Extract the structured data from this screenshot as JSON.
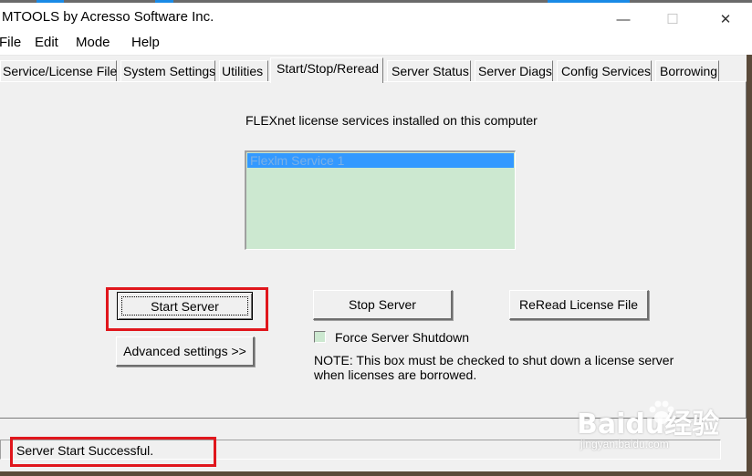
{
  "window": {
    "title": "MTOOLS by Acresso Software Inc.",
    "controls": {
      "minimize": "—",
      "maximize": "☐",
      "close": "✕"
    }
  },
  "menu": [
    "File",
    "Edit",
    "Mode",
    "Help"
  ],
  "tabs": [
    {
      "label": "Service/License File",
      "active": false
    },
    {
      "label": "System Settings",
      "active": false
    },
    {
      "label": "Utilities",
      "active": false
    },
    {
      "label": "Start/Stop/Reread",
      "active": true
    },
    {
      "label": "Server Status",
      "active": false
    },
    {
      "label": "Server Diags",
      "active": false
    },
    {
      "label": "Config Services",
      "active": false
    },
    {
      "label": "Borrowing",
      "active": false
    }
  ],
  "main": {
    "services_heading": "FLEXnet license services installed on this computer",
    "services": [
      "Flexlm Service 1"
    ],
    "buttons": {
      "start_server": "Start Server",
      "stop_server": "Stop Server",
      "reread": "ReRead License File",
      "advanced": "Advanced settings >>"
    },
    "force_shutdown_label": "Force Server Shutdown",
    "force_shutdown_checked": false,
    "note_line1": "NOTE:  This box must be checked to shut down a license server",
    "note_line2": "when licenses are borrowed."
  },
  "status": {
    "text": "Server Start Successful."
  },
  "watermark": {
    "main": "Baidu经验",
    "sub": "jingyan.baidu.com"
  },
  "colors": {
    "highlight": "#3399ff",
    "listbox_bg": "#cce8d0",
    "annotation_red": "#e0161c"
  }
}
